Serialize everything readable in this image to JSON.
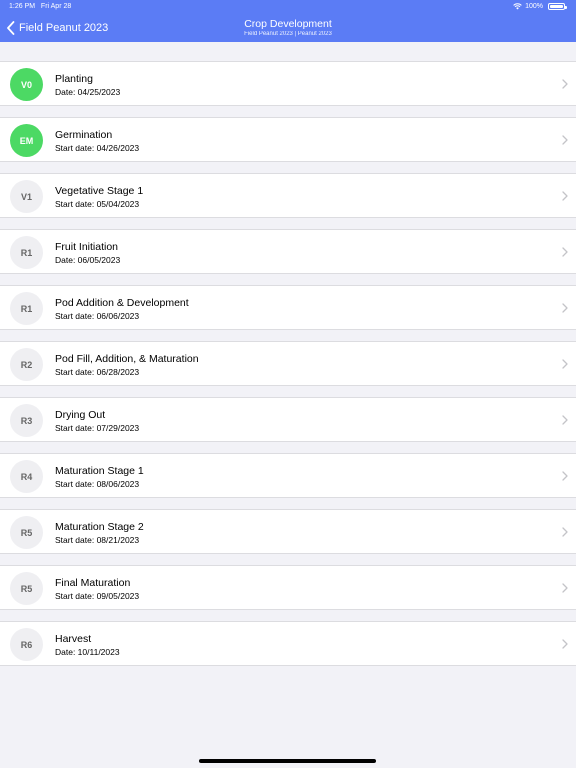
{
  "status": {
    "time": "1:26 PM",
    "date": "Fri Apr 28",
    "battery": "100%"
  },
  "nav": {
    "back_label": "Field Peanut 2023",
    "title": "Crop Development",
    "subtitle": "Field Peanut 2023 | Peanut 2023"
  },
  "colors": {
    "header": "#5b7cf5",
    "active_badge": "#4cd964",
    "inactive_badge": "#efeff2"
  },
  "stages": [
    {
      "code": "V0",
      "name": "Planting",
      "date": "Date: 04/25/2023",
      "active": true
    },
    {
      "code": "EM",
      "name": "Germination",
      "date": "Start date: 04/26/2023",
      "active": true
    },
    {
      "code": "V1",
      "name": "Vegetative Stage 1",
      "date": "Start date: 05/04/2023",
      "active": false
    },
    {
      "code": "R1",
      "name": "Fruit Initiation",
      "date": "Date: 06/05/2023",
      "active": false
    },
    {
      "code": "R1",
      "name": "Pod Addition & Development",
      "date": "Start date: 06/06/2023",
      "active": false
    },
    {
      "code": "R2",
      "name": "Pod Fill, Addition, & Maturation",
      "date": "Start date: 06/28/2023",
      "active": false
    },
    {
      "code": "R3",
      "name": "Drying Out",
      "date": "Start date: 07/29/2023",
      "active": false
    },
    {
      "code": "R4",
      "name": "Maturation Stage 1",
      "date": "Start date: 08/06/2023",
      "active": false
    },
    {
      "code": "R5",
      "name": "Maturation Stage 2",
      "date": "Start date: 08/21/2023",
      "active": false
    },
    {
      "code": "R5",
      "name": "Final Maturation",
      "date": "Start date: 09/05/2023",
      "active": false
    },
    {
      "code": "R6",
      "name": "Harvest",
      "date": "Date: 10/11/2023",
      "active": false
    }
  ]
}
